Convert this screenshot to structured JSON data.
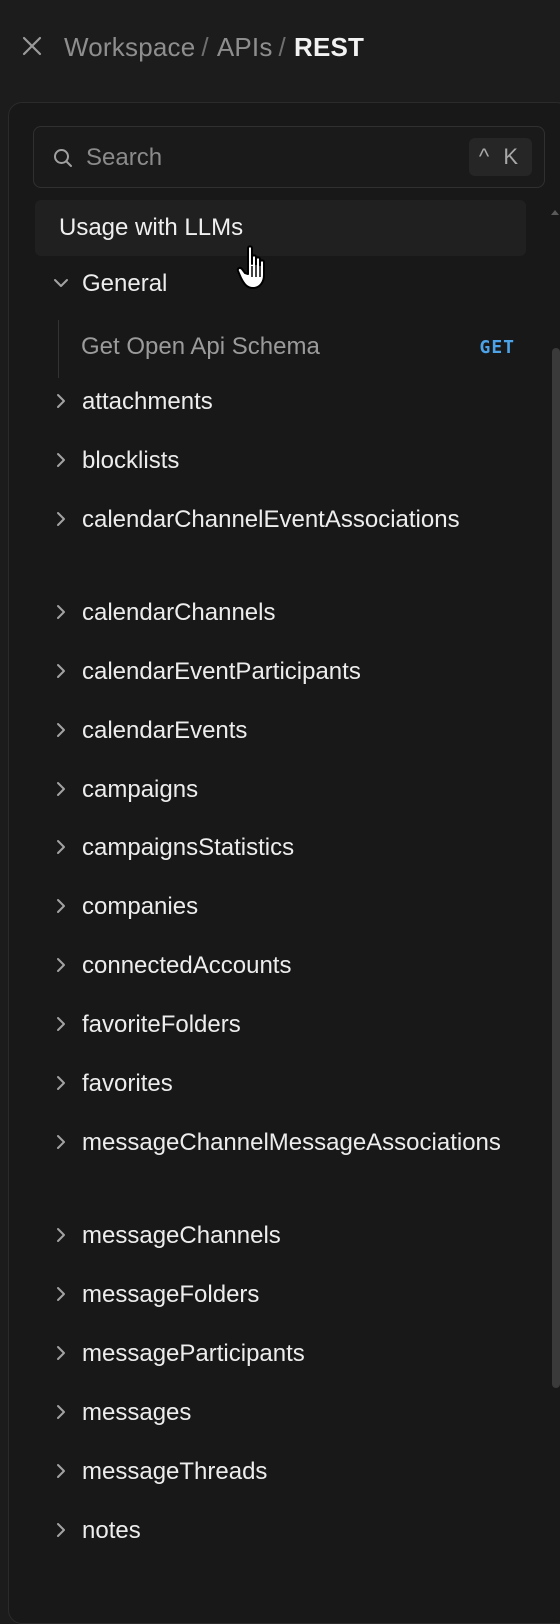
{
  "header": {
    "close_icon": "close-icon",
    "breadcrumb": [
      "Workspace",
      "APIs"
    ],
    "separator": "/",
    "current": "REST"
  },
  "search": {
    "icon": "search-icon",
    "placeholder": "Search",
    "shortcut": "^ K"
  },
  "nav": {
    "usage_label": "Usage with LLMs",
    "general": {
      "label": "General",
      "expanded": true,
      "children": [
        {
          "label": "Get Open Api Schema",
          "method": "GET",
          "method_color": "#4da3e8"
        }
      ]
    },
    "items": [
      "attachments",
      "blocklists",
      "calendarChannelEventAssociations",
      "calendarChannels",
      "calendarEventParticipants",
      "calendarEvents",
      "campaigns",
      "campaignsStatistics",
      "companies",
      "connectedAccounts",
      "favoriteFolders",
      "favorites",
      "messageChannelMessageAssociations",
      "messageChannels",
      "messageFolders",
      "messageParticipants",
      "messages",
      "messageThreads",
      "notes"
    ]
  },
  "colors": {
    "background": "#1c1c1c",
    "panel": "#181818",
    "text": "#ededed",
    "muted": "#8e8e8e",
    "accent_get": "#4da3e8"
  }
}
